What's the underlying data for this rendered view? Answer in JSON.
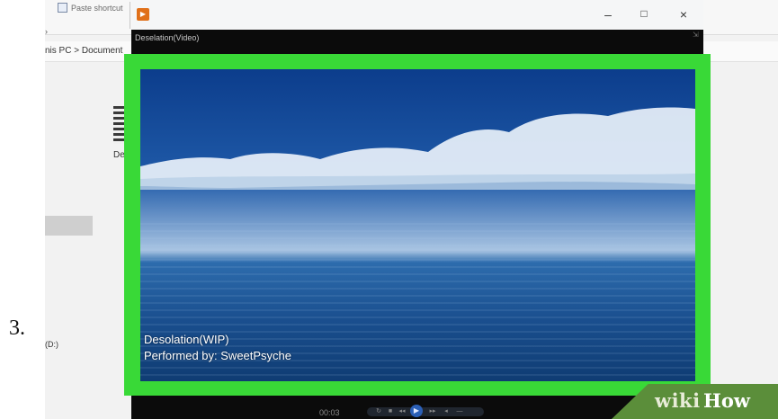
{
  "step": {
    "number": "3."
  },
  "explorer": {
    "ribbon_item": "Paste shortcut",
    "breadcrumb": "nis PC  >  Document",
    "file_label": "De",
    "drive_label": "(D:)"
  },
  "player": {
    "window_controls": {
      "minimize": "–",
      "maximize": "□",
      "close": "×"
    },
    "video_title": "Deselation(Video)",
    "caption": {
      "line1": "Desolation(WIP)",
      "line2": "Performed by: SweetPsyche"
    },
    "time": "00:03"
  },
  "highlight": {
    "color": "#39d937"
  },
  "watermark": {
    "brand_part1": "wiki",
    "brand_part2": "How"
  }
}
